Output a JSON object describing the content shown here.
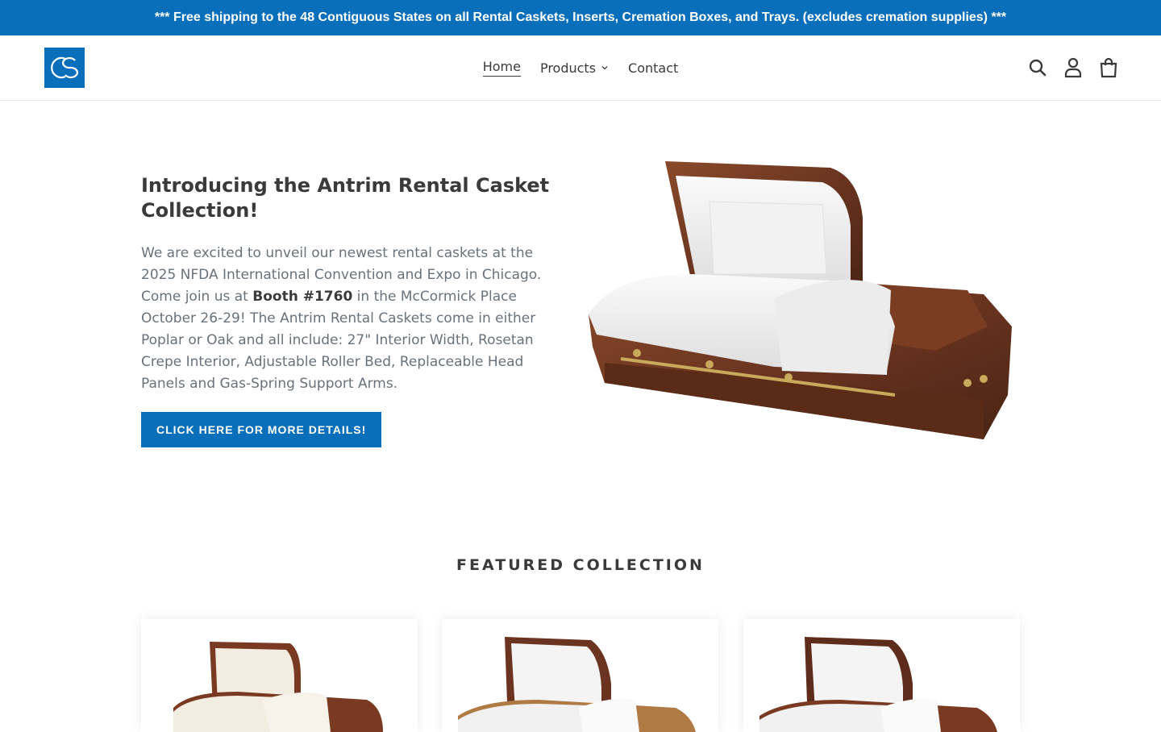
{
  "announcement": "*** Free shipping to the 48 Contiguous States on all Rental Caskets, Inserts, Cremation Boxes, and Trays. (excludes cremation supplies) ***",
  "nav": {
    "items": [
      {
        "label": "Home"
      },
      {
        "label": "Products"
      },
      {
        "label": "Contact"
      }
    ]
  },
  "hero": {
    "title": "Introducing the Antrim Rental Casket Collection!",
    "text_before": "We are excited to unveil our newest rental caskets at the 2025 NFDA International Convention and Expo in Chicago. Come join us at ",
    "text_bold": "Booth #1760",
    "text_after": " in the McCormick Place October 26-29! The Antrim Rental Caskets come in either Poplar or Oak and all include: 27\" Interior Width, Rosetan Crepe Interior, Adjustable Roller Bed, Replaceable Head Panels and Gas-Spring Support Arms.",
    "button": "CLICK HERE FOR MORE DETAILS!"
  },
  "featured": {
    "title": "FEATURED COLLECTION"
  },
  "colors": {
    "brand": "#0a6fba",
    "text": "#3a3a3a",
    "muted": "#69727b"
  },
  "icons": [
    "search-icon",
    "account-icon",
    "cart-icon",
    "chevron-down-icon"
  ]
}
